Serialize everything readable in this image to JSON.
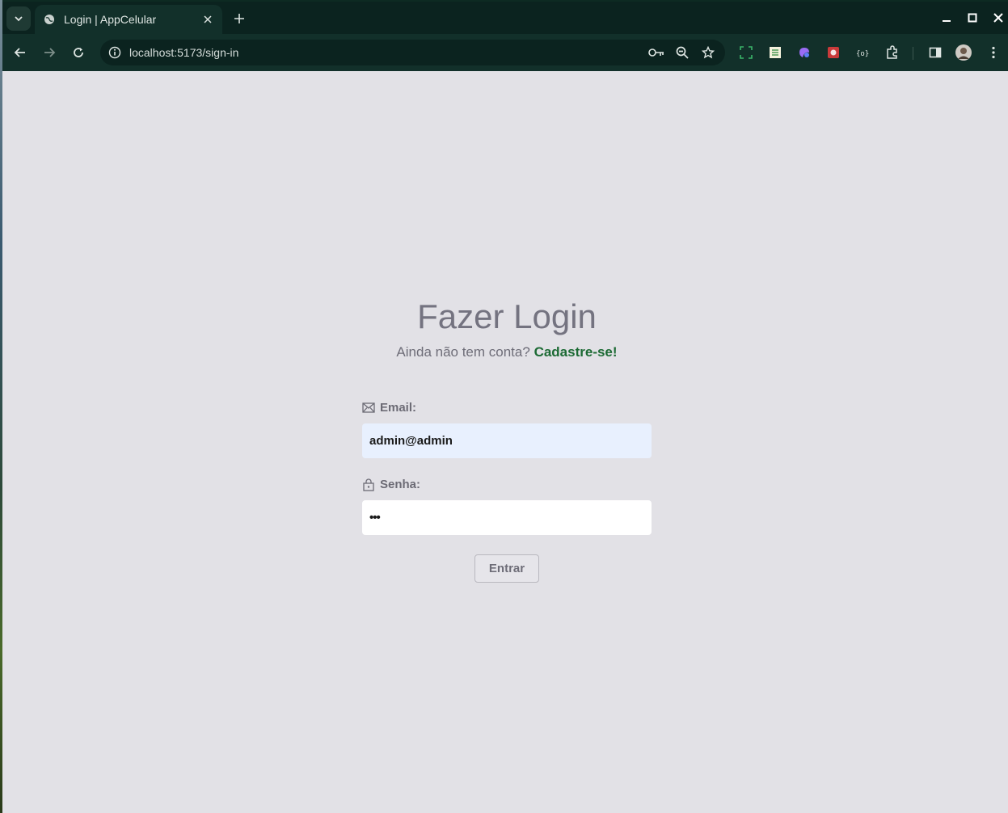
{
  "browser": {
    "tab_title": "Login | AppCelular",
    "url": "localhost:5173/sign-in"
  },
  "login": {
    "heading": "Fazer Login",
    "subtitle_text": "Ainda não tem conta?",
    "signup_link": "Cadastre-se!",
    "email_label": "Email:",
    "email_value": "admin@admin",
    "password_label": "Senha:",
    "password_value": "•••",
    "submit_label": "Entrar"
  },
  "colors": {
    "page_background": "#e2e1e6",
    "link": "#1c6a34",
    "browser_frame": "#12302a"
  }
}
